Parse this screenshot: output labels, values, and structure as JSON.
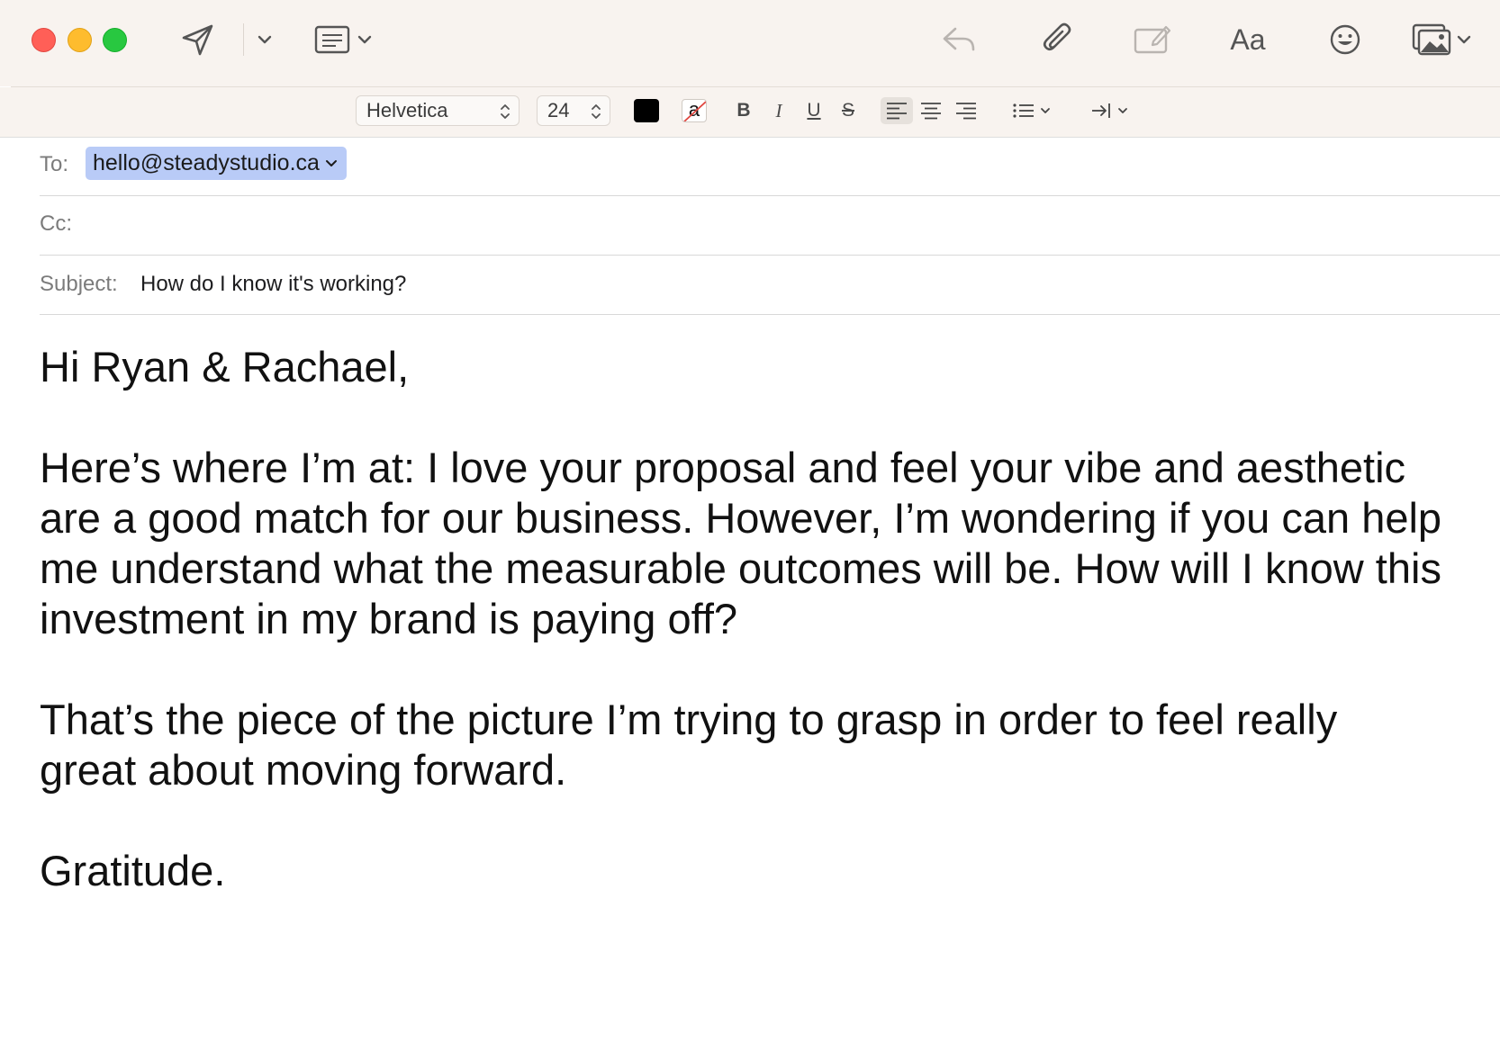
{
  "window": {
    "traffic_lights": [
      {
        "name": "close",
        "color": "#ff5f57"
      },
      {
        "name": "minimize",
        "color": "#febc2e"
      },
      {
        "name": "zoom",
        "color": "#28c840"
      }
    ]
  },
  "toolbar": {
    "icons": [
      "send-icon",
      "chevron-down-icon",
      "header-fields-icon",
      "reply-icon",
      "paperclip-icon",
      "markup-icon",
      "format-icon",
      "emoji-icon",
      "photo-browser-icon"
    ],
    "format_label": "Aa"
  },
  "format_bar": {
    "font_family": "Helvetica",
    "font_size": "24",
    "text_color": "#000000",
    "highlight_label": "a",
    "bold": "B",
    "italic": "I",
    "underline": "U",
    "strikethrough": "S"
  },
  "compose": {
    "to_label": "To:",
    "to_value": "hello@steadystudio.ca",
    "cc_label": "Cc:",
    "cc_value": "",
    "subject_label": "Subject:",
    "subject_value": "How do I know it's working?"
  },
  "message": {
    "greeting": "Hi Ryan & Rachael,",
    "paragraph1": "Here’s where I’m at: I love your proposal and feel your vibe and aesthetic are a good match for our business. However, I’m wondering if you can help me understand what the measurable outcomes will be. How will I know this investment in my brand is paying off?",
    "paragraph2": "That’s the piece of the picture I’m trying to grasp in order to feel really great about moving forward.",
    "signoff": "Gratitude."
  }
}
